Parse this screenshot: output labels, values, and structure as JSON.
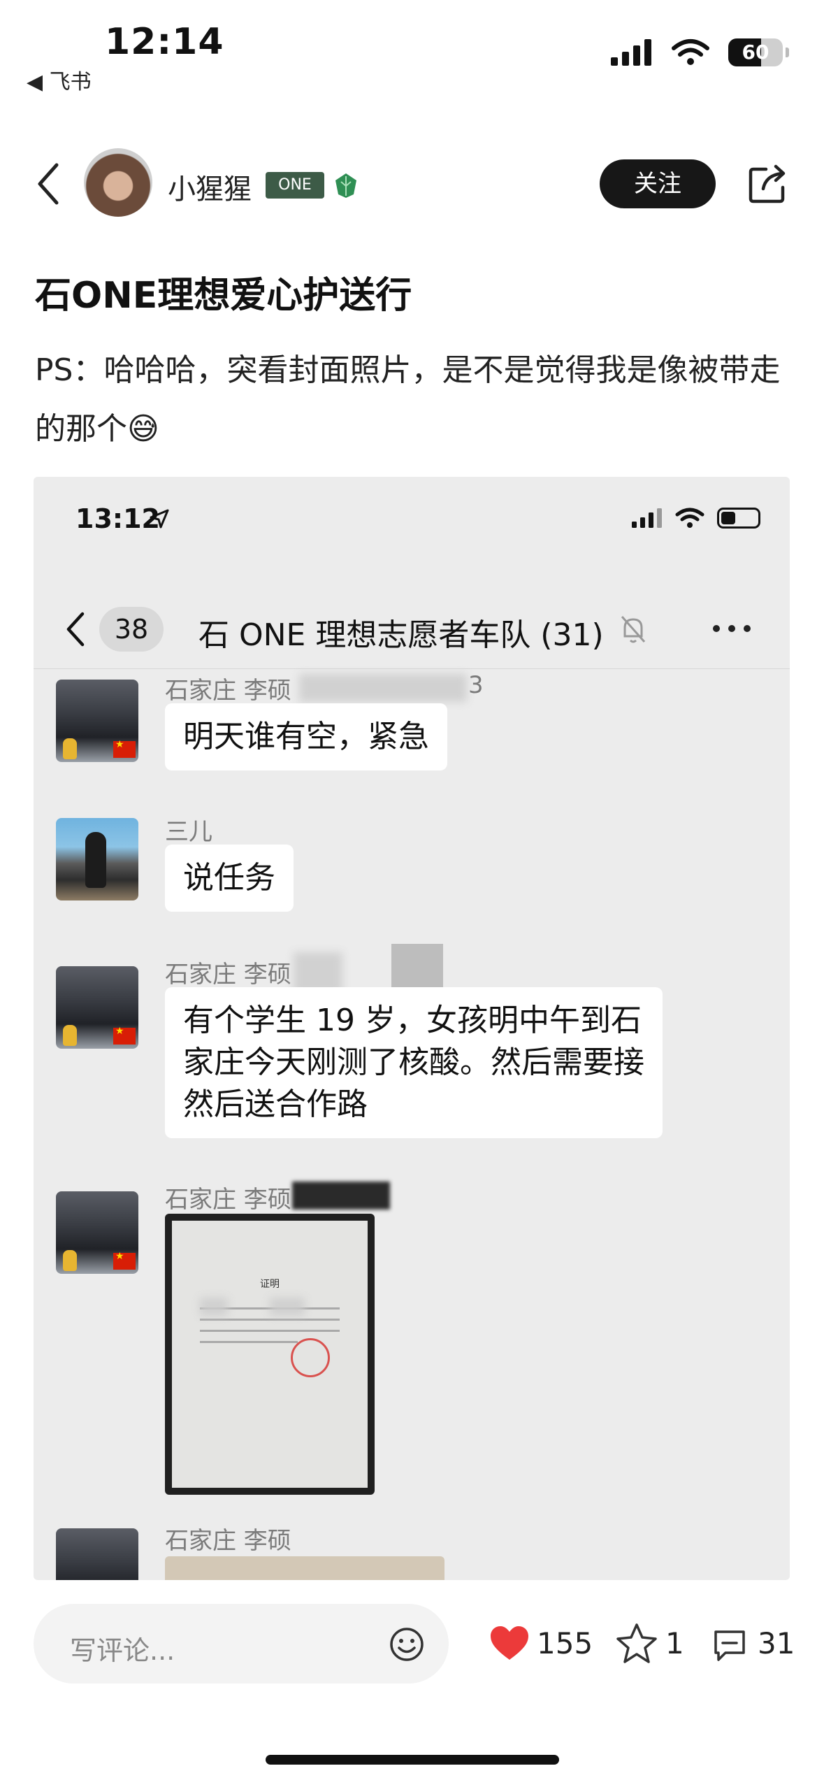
{
  "status_bar": {
    "time": "12:14",
    "back_app": "◀ 飞书",
    "battery": "60",
    "battery_level": 0.6
  },
  "header": {
    "username": "小猩猩",
    "badge": "ONE",
    "follow_label": "关注"
  },
  "post": {
    "title": "石ONE理想爱心护送行",
    "body": "PS：哈哈哈，突看封面照片，是不是觉得我是像被带走的那个😅"
  },
  "embedded_chat": {
    "time": "13:12",
    "back_count": "38",
    "group_title": "石 ONE 理想志愿者车队 (31)",
    "messages": [
      {
        "sender": "石家庄 李硕",
        "sender_suffix": "3",
        "text": "明天谁有空，紧急"
      },
      {
        "sender": "三儿",
        "text": "说任务"
      },
      {
        "sender": "石家庄 李硕",
        "text": "有个学生 19 岁，女孩明中午到石家庄今天刚测了核酸。然后需要接然后送合作路"
      },
      {
        "sender": "石家庄 李硕",
        "image_caption": "证明"
      },
      {
        "sender": "石家庄 李硕"
      }
    ]
  },
  "bottom_bar": {
    "comment_placeholder": "写评论...",
    "likes": "155",
    "favorites": "1",
    "comments": "31"
  }
}
